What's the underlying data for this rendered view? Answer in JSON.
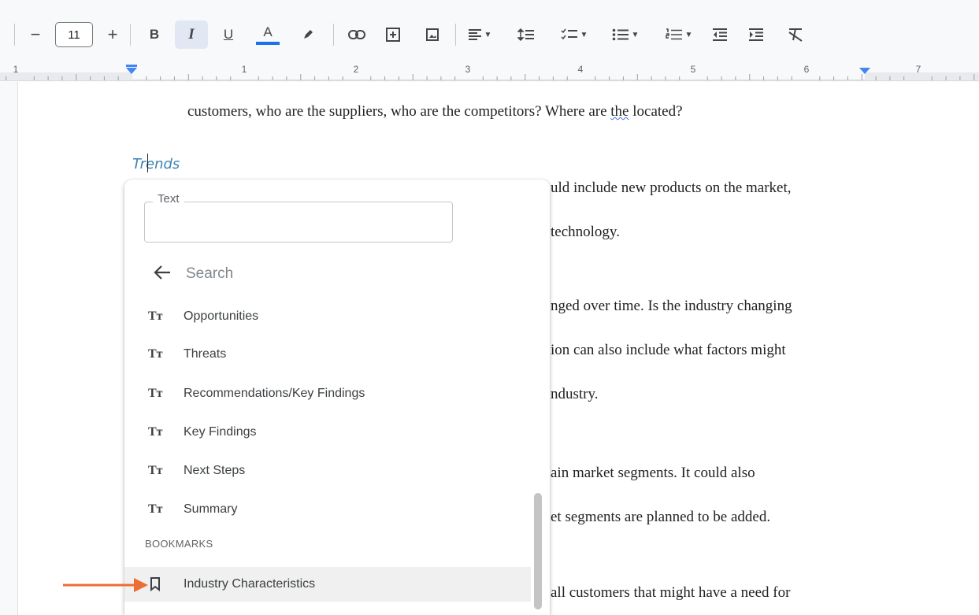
{
  "toolbar": {
    "font_size": "11",
    "minus_label": "−",
    "plus_label": "+",
    "bold_label": "B",
    "italic_label": "I",
    "underline_label": "U",
    "text_color_label": "A",
    "text_color_bar": "#1a73e8",
    "icons": [
      "highlighter-icon",
      "link-icon",
      "comment-icon",
      "image-icon",
      "align-icon",
      "line-spacing-icon",
      "checklist-icon",
      "bulleted-list-icon",
      "numbered-list-icon",
      "decrease-indent-icon",
      "increase-indent-icon",
      "clear-formatting-icon"
    ]
  },
  "ruler": {
    "numbers": [
      "1",
      "1",
      "2",
      "3",
      "4",
      "5",
      "6",
      "7"
    ],
    "marker_color": "#4285f4"
  },
  "document": {
    "line1_a": "customers, who are the suppliers, who are the competitors? Where are ",
    "line1_b": "the",
    "line1_c": " located?",
    "heading": "Trends",
    "right_lines": [
      "uld include new products on the market,",
      "technology.",
      "nged over time.  Is the industry changing",
      "ion can also include what factors might",
      "ndustry.",
      "ain market segments.  It could also",
      "et segments are planned to be added.",
      "all customers that might have a need for"
    ]
  },
  "popup": {
    "text_label": "Text",
    "text_value": "",
    "search_placeholder": "Search",
    "tt_glyph": "Tᴛ",
    "headings": [
      "Opportunities",
      "Threats",
      "Recommendations/Key Findings",
      "Key Findings",
      "Next Steps",
      "Summary"
    ],
    "bookmarks_header": "BOOKMARKS",
    "bookmarks": [
      "Industry Characteristics"
    ]
  },
  "colors": {
    "heading": "#3a82b5",
    "arrow": "#ec6e35",
    "hover": "#f0f0f0"
  }
}
